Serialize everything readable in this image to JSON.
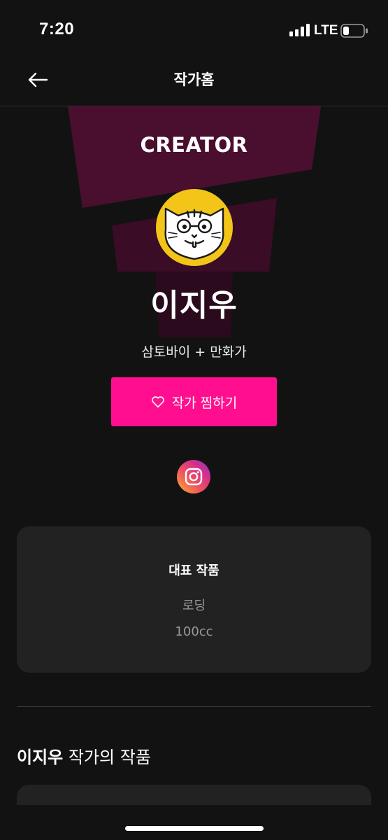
{
  "status_bar": {
    "time": "7:20",
    "network": "LTE",
    "battery_level": 0.25
  },
  "header": {
    "title": "작가홈",
    "back_icon": "arrow-left-icon"
  },
  "hero": {
    "badge": "CREATOR",
    "avatar_icon": "cat-with-glasses-avatar",
    "name": "이지우",
    "subtitle": "삼토바이 + 만화가"
  },
  "follow": {
    "label": "작가 찜하기",
    "icon": "heart-outline-icon"
  },
  "social": {
    "instagram_icon": "instagram-icon"
  },
  "representative_works": {
    "title": "대표 작품",
    "items": [
      "로딩",
      "100cc"
    ]
  },
  "works_section": {
    "name": "이지우",
    "suffix": " 작가의 작품"
  },
  "colors": {
    "background": "#121212",
    "accent": "#ff0f8f",
    "card": "#222222",
    "hero_shape": "#4a0f2e"
  }
}
